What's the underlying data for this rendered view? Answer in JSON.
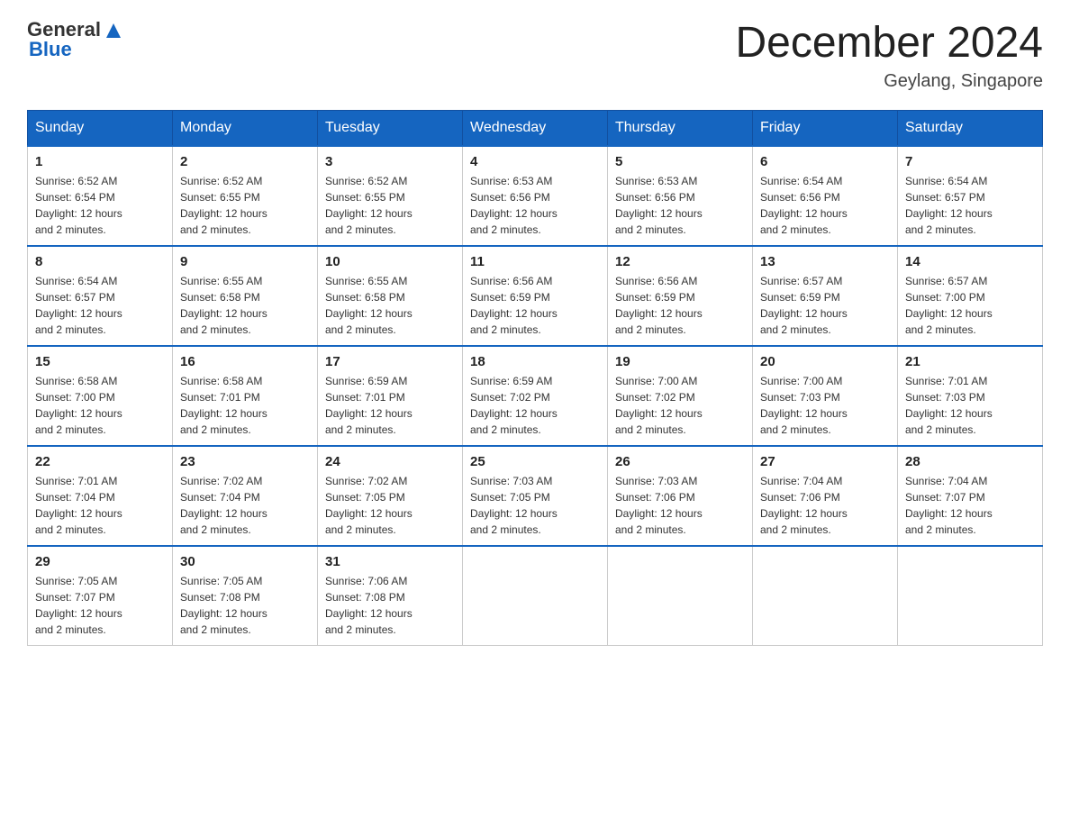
{
  "header": {
    "logo_general": "General",
    "logo_blue": "Blue",
    "month_title": "December 2024",
    "location": "Geylang, Singapore"
  },
  "days_of_week": [
    "Sunday",
    "Monday",
    "Tuesday",
    "Wednesday",
    "Thursday",
    "Friday",
    "Saturday"
  ],
  "weeks": [
    [
      {
        "day": "1",
        "sunrise": "6:52 AM",
        "sunset": "6:54 PM",
        "daylight": "12 hours and 2 minutes."
      },
      {
        "day": "2",
        "sunrise": "6:52 AM",
        "sunset": "6:55 PM",
        "daylight": "12 hours and 2 minutes."
      },
      {
        "day": "3",
        "sunrise": "6:52 AM",
        "sunset": "6:55 PM",
        "daylight": "12 hours and 2 minutes."
      },
      {
        "day": "4",
        "sunrise": "6:53 AM",
        "sunset": "6:56 PM",
        "daylight": "12 hours and 2 minutes."
      },
      {
        "day": "5",
        "sunrise": "6:53 AM",
        "sunset": "6:56 PM",
        "daylight": "12 hours and 2 minutes."
      },
      {
        "day": "6",
        "sunrise": "6:54 AM",
        "sunset": "6:56 PM",
        "daylight": "12 hours and 2 minutes."
      },
      {
        "day": "7",
        "sunrise": "6:54 AM",
        "sunset": "6:57 PM",
        "daylight": "12 hours and 2 minutes."
      }
    ],
    [
      {
        "day": "8",
        "sunrise": "6:54 AM",
        "sunset": "6:57 PM",
        "daylight": "12 hours and 2 minutes."
      },
      {
        "day": "9",
        "sunrise": "6:55 AM",
        "sunset": "6:58 PM",
        "daylight": "12 hours and 2 minutes."
      },
      {
        "day": "10",
        "sunrise": "6:55 AM",
        "sunset": "6:58 PM",
        "daylight": "12 hours and 2 minutes."
      },
      {
        "day": "11",
        "sunrise": "6:56 AM",
        "sunset": "6:59 PM",
        "daylight": "12 hours and 2 minutes."
      },
      {
        "day": "12",
        "sunrise": "6:56 AM",
        "sunset": "6:59 PM",
        "daylight": "12 hours and 2 minutes."
      },
      {
        "day": "13",
        "sunrise": "6:57 AM",
        "sunset": "6:59 PM",
        "daylight": "12 hours and 2 minutes."
      },
      {
        "day": "14",
        "sunrise": "6:57 AM",
        "sunset": "7:00 PM",
        "daylight": "12 hours and 2 minutes."
      }
    ],
    [
      {
        "day": "15",
        "sunrise": "6:58 AM",
        "sunset": "7:00 PM",
        "daylight": "12 hours and 2 minutes."
      },
      {
        "day": "16",
        "sunrise": "6:58 AM",
        "sunset": "7:01 PM",
        "daylight": "12 hours and 2 minutes."
      },
      {
        "day": "17",
        "sunrise": "6:59 AM",
        "sunset": "7:01 PM",
        "daylight": "12 hours and 2 minutes."
      },
      {
        "day": "18",
        "sunrise": "6:59 AM",
        "sunset": "7:02 PM",
        "daylight": "12 hours and 2 minutes."
      },
      {
        "day": "19",
        "sunrise": "7:00 AM",
        "sunset": "7:02 PM",
        "daylight": "12 hours and 2 minutes."
      },
      {
        "day": "20",
        "sunrise": "7:00 AM",
        "sunset": "7:03 PM",
        "daylight": "12 hours and 2 minutes."
      },
      {
        "day": "21",
        "sunrise": "7:01 AM",
        "sunset": "7:03 PM",
        "daylight": "12 hours and 2 minutes."
      }
    ],
    [
      {
        "day": "22",
        "sunrise": "7:01 AM",
        "sunset": "7:04 PM",
        "daylight": "12 hours and 2 minutes."
      },
      {
        "day": "23",
        "sunrise": "7:02 AM",
        "sunset": "7:04 PM",
        "daylight": "12 hours and 2 minutes."
      },
      {
        "day": "24",
        "sunrise": "7:02 AM",
        "sunset": "7:05 PM",
        "daylight": "12 hours and 2 minutes."
      },
      {
        "day": "25",
        "sunrise": "7:03 AM",
        "sunset": "7:05 PM",
        "daylight": "12 hours and 2 minutes."
      },
      {
        "day": "26",
        "sunrise": "7:03 AM",
        "sunset": "7:06 PM",
        "daylight": "12 hours and 2 minutes."
      },
      {
        "day": "27",
        "sunrise": "7:04 AM",
        "sunset": "7:06 PM",
        "daylight": "12 hours and 2 minutes."
      },
      {
        "day": "28",
        "sunrise": "7:04 AM",
        "sunset": "7:07 PM",
        "daylight": "12 hours and 2 minutes."
      }
    ],
    [
      {
        "day": "29",
        "sunrise": "7:05 AM",
        "sunset": "7:07 PM",
        "daylight": "12 hours and 2 minutes."
      },
      {
        "day": "30",
        "sunrise": "7:05 AM",
        "sunset": "7:08 PM",
        "daylight": "12 hours and 2 minutes."
      },
      {
        "day": "31",
        "sunrise": "7:06 AM",
        "sunset": "7:08 PM",
        "daylight": "12 hours and 2 minutes."
      },
      null,
      null,
      null,
      null
    ]
  ],
  "labels": {
    "sunrise": "Sunrise:",
    "sunset": "Sunset:",
    "daylight": "Daylight:"
  }
}
